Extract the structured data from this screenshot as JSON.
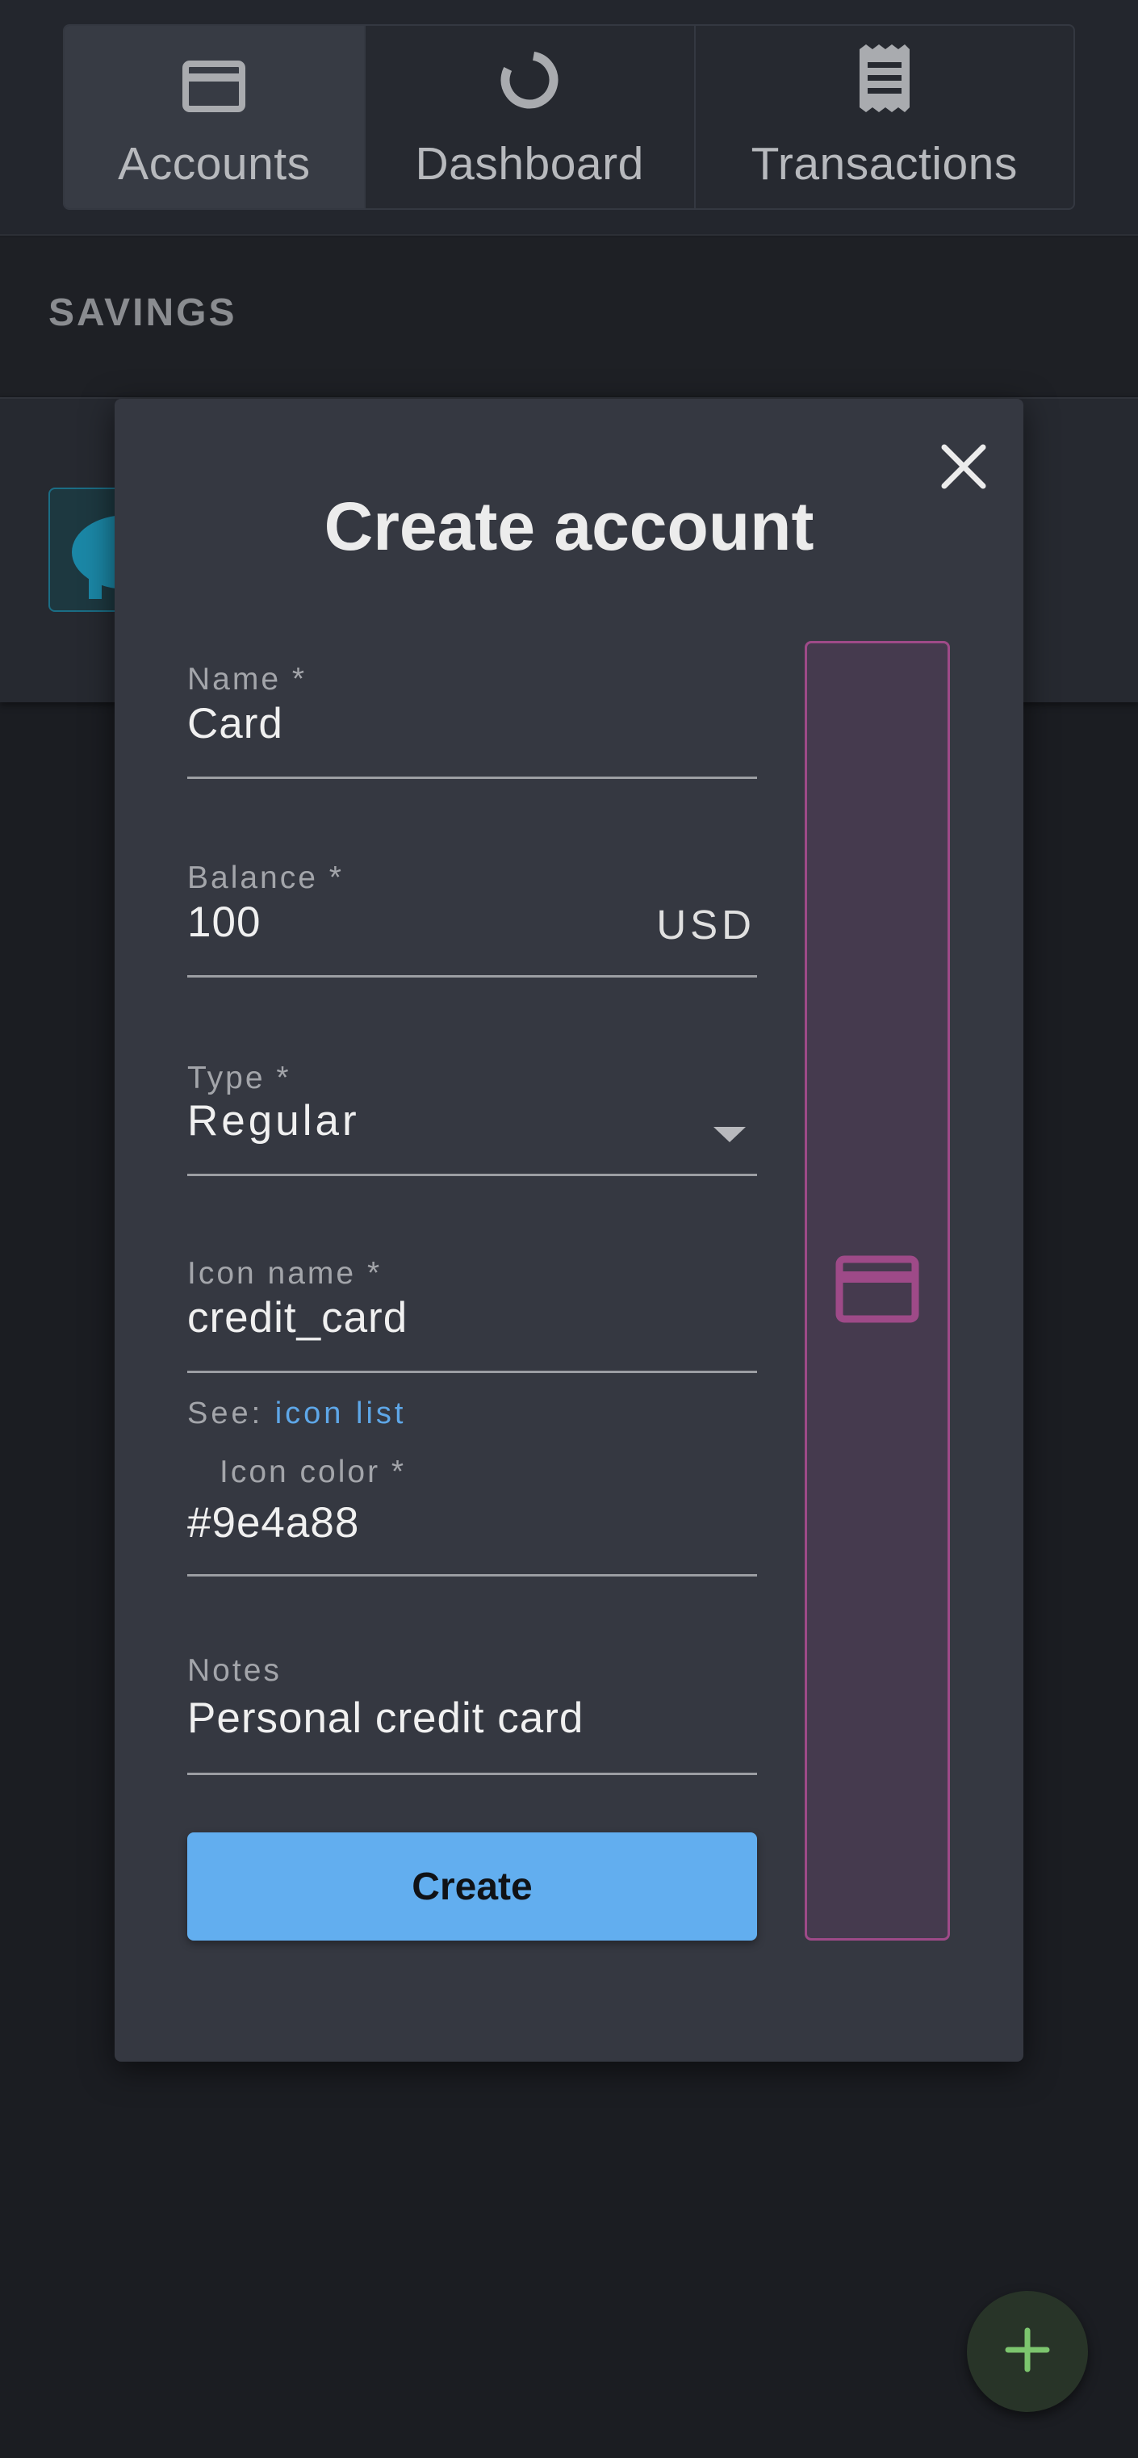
{
  "nav": {
    "tabs": [
      {
        "label": "Accounts",
        "icon": "credit-card-icon",
        "active": true
      },
      {
        "label": "Dashboard",
        "icon": "donut-chart-icon",
        "active": false
      },
      {
        "label": "Transactions",
        "icon": "receipt-icon",
        "active": false
      }
    ]
  },
  "background": {
    "section_title": "SAVINGS",
    "account_icon": "piggy-bank-icon"
  },
  "modal": {
    "title": "Create account",
    "close_icon": "close-icon",
    "fields": {
      "name": {
        "label": "Name *",
        "value": "Card"
      },
      "balance": {
        "label": "Balance *",
        "value": "100",
        "suffix": "USD"
      },
      "type": {
        "label": "Type *",
        "value": "Regular"
      },
      "icon_name": {
        "label": "Icon name *",
        "value": "credit_card"
      },
      "icon_color": {
        "label": "Icon color *",
        "value": "#9e4a88"
      },
      "notes": {
        "label": "Notes",
        "value": "Personal credit card"
      }
    },
    "helper": {
      "prefix": "See: ",
      "link": "icon list"
    },
    "submit_label": "Create",
    "preview": {
      "icon": "credit-card-icon",
      "color": "#9e4a88"
    }
  },
  "fab": {
    "icon": "plus-icon",
    "color": "#7cc56e"
  },
  "colors": {
    "accent": "#62aeef",
    "link": "#5ea7e8",
    "modal_bg": "#353841",
    "page_bg": "#1b1d22"
  }
}
